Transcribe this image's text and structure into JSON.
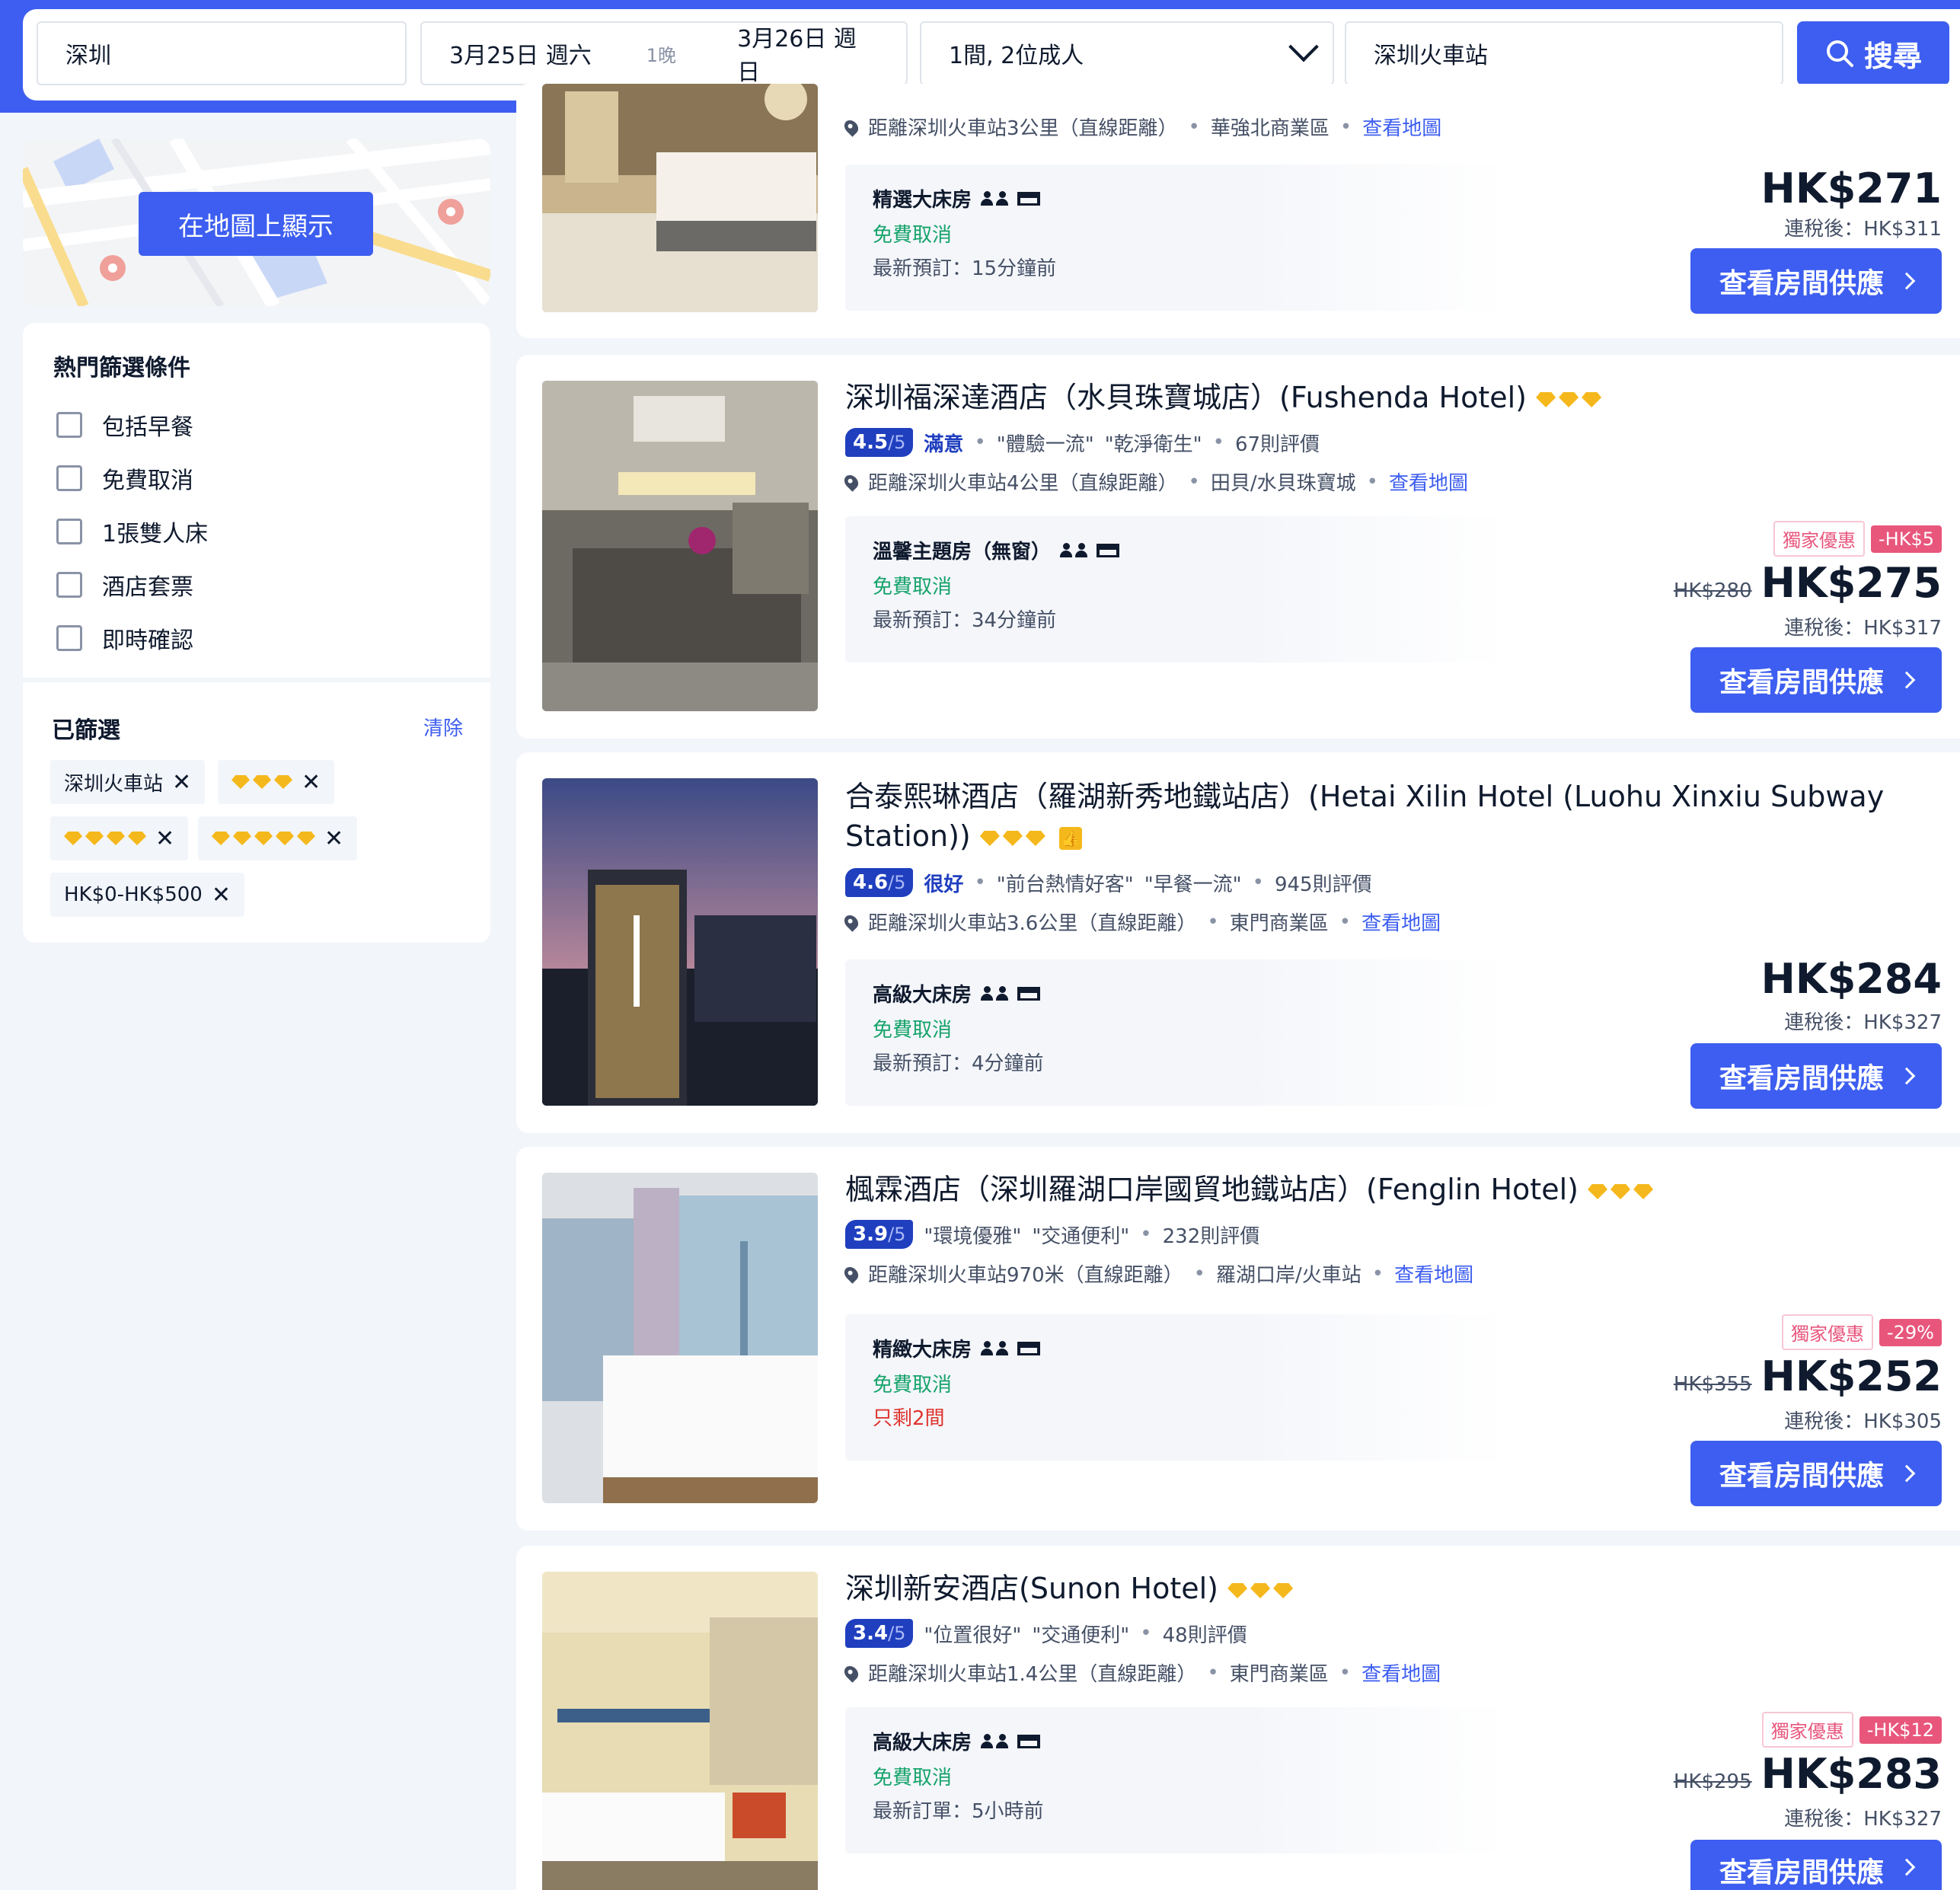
{
  "search": {
    "destination": "深圳",
    "checkin": "3月25日 週六",
    "nights": "1晚",
    "checkout": "3月26日 週日",
    "guests": "1間, 2位成人",
    "keyword": "深圳火車站",
    "search_label": "搜尋"
  },
  "map": {
    "show_on_map_label": "在地圖上顯示"
  },
  "filters": {
    "title": "熱門篩選條件",
    "items": [
      "包括早餐",
      "免費取消",
      "1張雙人床",
      "酒店套票",
      "即時確認"
    ]
  },
  "selected": {
    "title": "已篩選",
    "clear_label": "清除",
    "chips": [
      "深圳火車站",
      "HK$0-HK$500"
    ],
    "star_chips": [
      3,
      4,
      5
    ]
  },
  "hotels": [
    {
      "name": "",
      "stars": 0,
      "distance": "距離深圳火車站3公里（直線距離）",
      "area": "華強北商業區",
      "map_link": "查看地圖",
      "room": "精選大床房",
      "cancel": "免費取消",
      "last_booked": "最新預訂：15分鐘前",
      "price": "HK$271",
      "tax": "連稅後：HK$311",
      "button": "查看房間供應"
    },
    {
      "name": "深圳福深達酒店（水貝珠寶城店）(Fushenda Hotel)",
      "stars": 3,
      "score": "4.5",
      "score_max": "/5",
      "score_word": "滿意",
      "tags": [
        "\"體驗一流\"",
        "\"乾淨衛生\""
      ],
      "reviews": "67則評價",
      "distance": "距離深圳火車站4公里（直線距離）",
      "area": "田貝/水貝珠寶城",
      "map_link": "查看地圖",
      "room": "溫馨主題房（無窗）",
      "cancel": "免費取消",
      "last_booked": "最新預訂：34分鐘前",
      "promo": "獨家優惠",
      "discount": "-HK$5",
      "old_price": "HK$280",
      "price": "HK$275",
      "tax": "連稅後：HK$317",
      "button": "查看房間供應"
    },
    {
      "name": "合泰熙琳酒店（羅湖新秀地鐵站店）(Hetai Xilin Hotel (Luohu Xinxiu Subway Station))",
      "stars": 3,
      "score": "4.6",
      "score_max": "/5",
      "score_word": "很好",
      "tags": [
        "\"前台熱情好客\"",
        "\"早餐一流\""
      ],
      "reviews": "945則評價",
      "distance": "距離深圳火車站3.6公里（直線距離）",
      "area": "東門商業區",
      "map_link": "查看地圖",
      "room": "高級大床房",
      "cancel": "免費取消",
      "last_booked": "最新預訂：4分鐘前",
      "price": "HK$284",
      "tax": "連稅後：HK$327",
      "button": "查看房間供應"
    },
    {
      "name": "楓霖酒店（深圳羅湖口岸國貿地鐵站店）(Fenglin Hotel)",
      "stars": 3,
      "score": "3.9",
      "score_max": "/5",
      "score_word": "",
      "tags": [
        "\"環境優雅\"",
        "\"交通便利\""
      ],
      "reviews": "232則評價",
      "distance": "距離深圳火車站970米（直線距離）",
      "area": "羅湖口岸/火車站",
      "map_link": "查看地圖",
      "room": "精緻大床房",
      "cancel": "免費取消",
      "last_booked": "只剩2間",
      "promo": "獨家優惠",
      "discount": "-29%",
      "old_price": "HK$355",
      "price": "HK$252",
      "tax": "連稅後：HK$305",
      "button": "查看房間供應"
    },
    {
      "name": "深圳新安酒店(Sunon Hotel)",
      "stars": 3,
      "score": "3.4",
      "score_max": "/5",
      "score_word": "",
      "tags": [
        "\"位置很好\"",
        "\"交通便利\""
      ],
      "reviews": "48則評價",
      "distance": "距離深圳火車站1.4公里（直線距離）",
      "area": "東門商業區",
      "map_link": "查看地圖",
      "room": "高級大床房",
      "cancel": "免費取消",
      "last_booked": "最新訂單：5小時前",
      "promo": "獨家優惠",
      "discount": "-HK$12",
      "old_price": "HK$295",
      "price": "HK$283",
      "tax": "連稅後：HK$327",
      "button": "查看房間供應"
    }
  ],
  "colors": {
    "brand": "#3d5ef0",
    "star": "#f5b81c",
    "promo": "#e8567c",
    "free_cancel": "#16a36b"
  }
}
